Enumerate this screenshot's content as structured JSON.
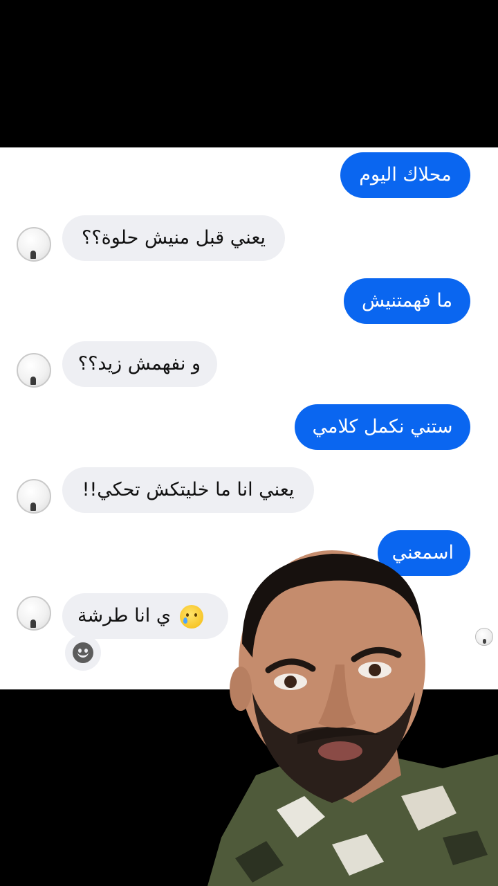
{
  "messages": [
    {
      "side": "out",
      "text": "محلاك اليوم"
    },
    {
      "side": "in",
      "text": "يعني قبل منيش حلوة؟؟"
    },
    {
      "side": "out",
      "text": "ما فهمتنيش"
    },
    {
      "side": "in",
      "text": "و نفهمش زيد؟؟"
    },
    {
      "side": "out",
      "text": "ستني نكمل كلامي"
    },
    {
      "side": "in",
      "text": "يعني انا ما خليتكش تحكي!!"
    },
    {
      "side": "out",
      "text": "اسمعني"
    },
    {
      "side": "in",
      "text": "ي انا طرشة",
      "emoji": "crying-smile-emoji"
    }
  ],
  "colors": {
    "outgoing_bubble": "#0a66f0",
    "incoming_bubble": "#eeeff3",
    "background_band": "#000000",
    "chat_background": "#ffffff"
  },
  "icons": [
    "avatar",
    "smiley-reaction-icon",
    "seen-avatar-icon"
  ]
}
